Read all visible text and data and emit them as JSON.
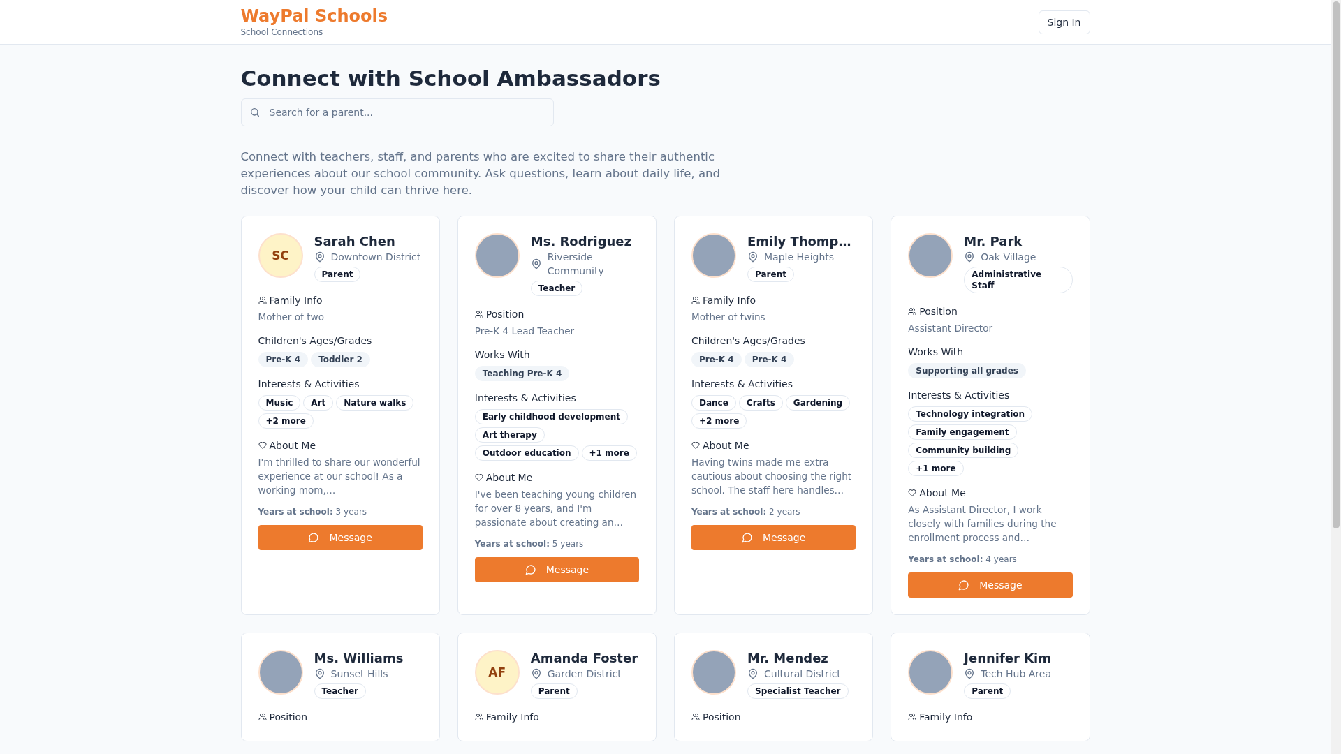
{
  "header": {
    "brand": "WayPal Schools",
    "tagline": "School Connections",
    "sign_in": "Sign In"
  },
  "page": {
    "title": "Connect with School Ambassadors",
    "search": {
      "placeholder": "Search for a parent..."
    },
    "intro": "Connect with teachers, staff, and parents who are excited to share their authentic experiences about our school community. Ask questions, learn about daily life, and discover how your child can thrive here."
  },
  "cards": [
    {
      "name": "Sarah Chen",
      "location": "Downtown District",
      "role": "Parent",
      "avatar": {
        "kind": "initials",
        "text": "SC"
      },
      "sections": [
        {
          "kind": "info",
          "label": "Family Info",
          "value": "Mother of two"
        },
        {
          "kind": "filled_tags",
          "label": "Children's Ages/Grades",
          "tags": [
            "Pre-K 4",
            "Toddler 2"
          ]
        },
        {
          "kind": "outline_tags",
          "label": "Interests & Activities",
          "tags": [
            "Music",
            "Art",
            "Nature walks",
            "+2 more"
          ]
        },
        {
          "kind": "about",
          "label": "About Me",
          "value": "I'm thrilled to share our wonderful experience at our school! As a working mom,…"
        }
      ],
      "years": "**Years at school:** 3 years",
      "button": "Message"
    },
    {
      "name": "Ms. Rodriguez",
      "location": "Riverside Community",
      "role": "Teacher",
      "avatar": {
        "kind": "photo"
      },
      "sections": [
        {
          "kind": "info",
          "label": "Position",
          "value": "Pre-K 4 Lead Teacher"
        },
        {
          "kind": "filled_tags",
          "label": "Works With",
          "tags": [
            "Teaching Pre-K 4"
          ]
        },
        {
          "kind": "outline_tags",
          "label": "Interests & Activities",
          "tags": [
            "Early childhood development",
            "Art therapy",
            "Outdoor education",
            "+1 more"
          ]
        },
        {
          "kind": "about",
          "label": "About Me",
          "value": "I've been teaching young children for over 8 years, and I'm passionate about creating an…"
        }
      ],
      "years": "**Years at school:** 5 years",
      "button": "Message"
    },
    {
      "name": "Emily Thomp…",
      "location": "Maple Heights",
      "role": "Parent",
      "avatar": {
        "kind": "photo"
      },
      "sections": [
        {
          "kind": "info",
          "label": "Family Info",
          "value": "Mother of twins"
        },
        {
          "kind": "filled_tags",
          "label": "Children's Ages/Grades",
          "tags": [
            "Pre-K 4",
            "Pre-K 4"
          ]
        },
        {
          "kind": "outline_tags",
          "label": "Interests & Activities",
          "tags": [
            "Dance",
            "Crafts",
            "Gardening",
            "+2 more"
          ]
        },
        {
          "kind": "about",
          "label": "About Me",
          "value": "Having twins made me extra cautious about choosing the right school. The staff here handles…"
        }
      ],
      "years": "**Years at school:** 2 years",
      "button": "Message"
    },
    {
      "name": "Mr. Park",
      "location": "Oak Village",
      "role": "Administrative Staff",
      "avatar": {
        "kind": "photo"
      },
      "sections": [
        {
          "kind": "info",
          "label": "Position",
          "value": "Assistant Director"
        },
        {
          "kind": "filled_tags",
          "label": "Works With",
          "tags": [
            "Supporting all grades"
          ]
        },
        {
          "kind": "outline_tags",
          "label": "Interests & Activities",
          "tags": [
            "Technology integration",
            "Family engagement",
            "Community building",
            "+1 more"
          ]
        },
        {
          "kind": "about",
          "label": "About Me",
          "value": "As Assistant Director, I work closely with families during the enrollment process and…"
        }
      ],
      "years": "**Years at school:** 4 years",
      "button": "Message"
    },
    {
      "name": "Ms. Williams",
      "location": "Sunset Hills",
      "role": "Teacher",
      "avatar": {
        "kind": "photo"
      },
      "sections": [
        {
          "kind": "info",
          "label": "Position"
        }
      ]
    },
    {
      "name": "Amanda Foster",
      "location": "Garden District",
      "role": "Parent",
      "avatar": {
        "kind": "initials",
        "text": "AF"
      },
      "sections": [
        {
          "kind": "info",
          "label": "Family Info"
        }
      ]
    },
    {
      "name": "Mr. Mendez",
      "location": "Cultural District",
      "role": "Specialist Teacher",
      "avatar": {
        "kind": "photo"
      },
      "sections": [
        {
          "kind": "info",
          "label": "Position"
        }
      ]
    },
    {
      "name": "Jennifer Kim",
      "location": "Tech Hub Area",
      "role": "Parent",
      "avatar": {
        "kind": "photo"
      },
      "sections": [
        {
          "kind": "info",
          "label": "Family Info"
        }
      ]
    }
  ]
}
